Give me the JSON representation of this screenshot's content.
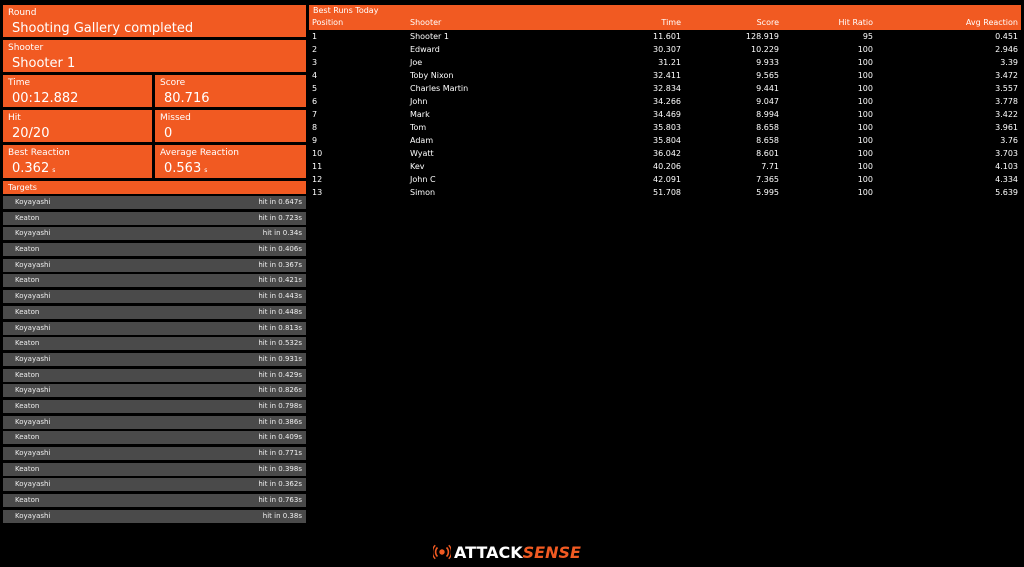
{
  "panels": {
    "round": {
      "label": "Round",
      "value": "Shooting Gallery completed"
    },
    "shooter": {
      "label": "Shooter",
      "value": "Shooter 1"
    },
    "time": {
      "label": "Time",
      "value": "00:12.882"
    },
    "score": {
      "label": "Score",
      "value": "80.716"
    },
    "hit": {
      "label": "Hit",
      "value": "20/20"
    },
    "missed": {
      "label": "Missed",
      "value": "0"
    },
    "best_reaction": {
      "label": "Best Reaction",
      "value": "0.362",
      "unit": "s"
    },
    "average_reaction": {
      "label": "Average Reaction",
      "value": "0.563",
      "unit": "s"
    }
  },
  "targets": {
    "title": "Targets",
    "items": [
      {
        "name": "Koyayashi",
        "result": "hit in 0.647s"
      },
      {
        "name": "Keaton",
        "result": "hit in 0.723s"
      },
      {
        "name": "Koyayashi",
        "result": "hit in 0.34s"
      },
      {
        "name": "Keaton",
        "result": "hit in 0.406s"
      },
      {
        "name": "Koyayashi",
        "result": "hit in 0.367s"
      },
      {
        "name": "Keaton",
        "result": "hit in 0.421s"
      },
      {
        "name": "Koyayashi",
        "result": "hit in 0.443s"
      },
      {
        "name": "Keaton",
        "result": "hit in 0.448s"
      },
      {
        "name": "Koyayashi",
        "result": "hit in 0.813s"
      },
      {
        "name": "Keaton",
        "result": "hit in 0.532s"
      },
      {
        "name": "Koyayashi",
        "result": "hit in 0.931s"
      },
      {
        "name": "Keaton",
        "result": "hit in 0.429s"
      },
      {
        "name": "Koyayashi",
        "result": "hit in 0.826s"
      },
      {
        "name": "Keaton",
        "result": "hit in 0.798s"
      },
      {
        "name": "Koyayashi",
        "result": "hit in 0.386s"
      },
      {
        "name": "Keaton",
        "result": "hit in 0.409s"
      },
      {
        "name": "Koyayashi",
        "result": "hit in 0.771s"
      },
      {
        "name": "Keaton",
        "result": "hit in 0.398s"
      },
      {
        "name": "Koyayashi",
        "result": "hit in 0.362s"
      },
      {
        "name": "Keaton",
        "result": "hit in 0.763s"
      },
      {
        "name": "Koyayashi",
        "result": "hit in 0.38s"
      }
    ]
  },
  "best_runs": {
    "title": "Best Runs Today",
    "columns": {
      "position": "Position",
      "shooter": "Shooter",
      "time": "Time",
      "score": "Score",
      "hit_ratio": "Hit Ratio",
      "avg_reaction": "Avg Reaction"
    },
    "rows": [
      {
        "position": "1",
        "shooter": "Shooter 1",
        "time": "11.601",
        "score": "128.919",
        "hit_ratio": "95",
        "avg_reaction": "0.451"
      },
      {
        "position": "2",
        "shooter": "Edward",
        "time": "30.307",
        "score": "10.229",
        "hit_ratio": "100",
        "avg_reaction": "2.946"
      },
      {
        "position": "3",
        "shooter": "Joe",
        "time": "31.21",
        "score": "9.933",
        "hit_ratio": "100",
        "avg_reaction": "3.39"
      },
      {
        "position": "4",
        "shooter": "Toby Nixon",
        "time": "32.411",
        "score": "9.565",
        "hit_ratio": "100",
        "avg_reaction": "3.472"
      },
      {
        "position": "5",
        "shooter": "Charles Martin",
        "time": "32.834",
        "score": "9.441",
        "hit_ratio": "100",
        "avg_reaction": "3.557"
      },
      {
        "position": "6",
        "shooter": "John",
        "time": "34.266",
        "score": "9.047",
        "hit_ratio": "100",
        "avg_reaction": "3.778"
      },
      {
        "position": "7",
        "shooter": "Mark",
        "time": "34.469",
        "score": "8.994",
        "hit_ratio": "100",
        "avg_reaction": "3.422"
      },
      {
        "position": "8",
        "shooter": "Tom",
        "time": "35.803",
        "score": "8.658",
        "hit_ratio": "100",
        "avg_reaction": "3.961"
      },
      {
        "position": "9",
        "shooter": "Adam",
        "time": "35.804",
        "score": "8.658",
        "hit_ratio": "100",
        "avg_reaction": "3.76"
      },
      {
        "position": "10",
        "shooter": "Wyatt",
        "time": "36.042",
        "score": "8.601",
        "hit_ratio": "100",
        "avg_reaction": "3.703"
      },
      {
        "position": "11",
        "shooter": "Kev",
        "time": "40.206",
        "score": "7.71",
        "hit_ratio": "100",
        "avg_reaction": "4.103"
      },
      {
        "position": "12",
        "shooter": "John C",
        "time": "42.091",
        "score": "7.365",
        "hit_ratio": "100",
        "avg_reaction": "4.334"
      },
      {
        "position": "13",
        "shooter": "Simon",
        "time": "51.708",
        "score": "5.995",
        "hit_ratio": "100",
        "avg_reaction": "5.639"
      }
    ]
  },
  "logo": {
    "text_a": "ATTACK",
    "text_b": "SENSE",
    "icon": "target-signal-icon"
  },
  "colors": {
    "accent": "#f15a22",
    "row_bg": "#4a4a4a",
    "background": "#000000"
  }
}
